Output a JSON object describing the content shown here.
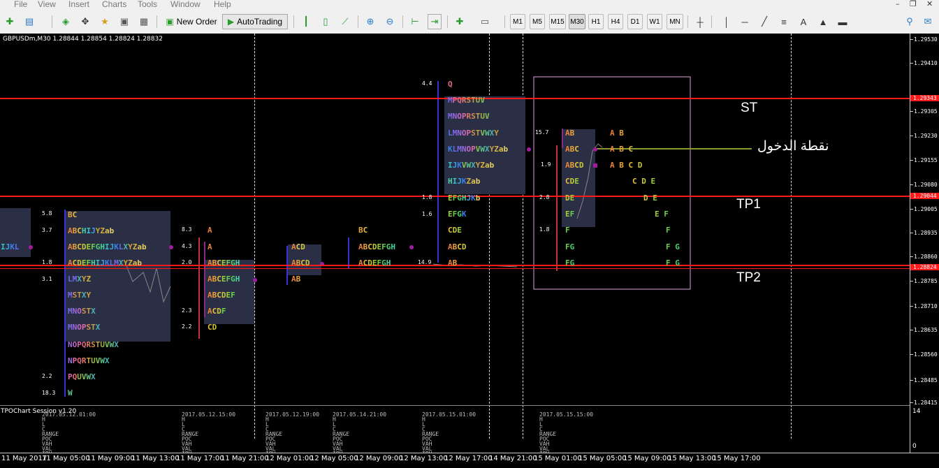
{
  "menu": [
    "File",
    "View",
    "Insert",
    "Charts",
    "Tools",
    "Window",
    "Help"
  ],
  "window_buttons": {
    "minimize": "–",
    "restore": "❐",
    "close": "✕"
  },
  "toolbar": {
    "new_order": "New Order",
    "auto_trading": "AutoTrading",
    "timeframes": [
      "M1",
      "M5",
      "M15",
      "M30",
      "H1",
      "H4",
      "D1",
      "W1",
      "MN"
    ],
    "active_timeframe": "M30"
  },
  "chart": {
    "symbol_info": "GBPUSDm,M30  1.28844 1.28854 1.28824 1.28832",
    "price_labels": [
      "1.29530",
      "1.29410",
      "1.29343",
      "1.29305",
      "1.29230",
      "1.29155",
      "1.29080",
      "1.29044",
      "1.29005",
      "1.28935",
      "1.28860",
      "1.28824",
      "1.28785",
      "1.28710",
      "1.28635",
      "1.28560",
      "1.28485",
      "1.28415"
    ],
    "highlighted_prices": [
      "1.29343",
      "1.29044",
      "1.28824"
    ],
    "time_labels": [
      "11 May 2017",
      "11 May 05:00",
      "11 May 09:00",
      "11 May 13:00",
      "11 May 17:00",
      "11 May 21:00",
      "12 May 01:00",
      "12 May 05:00",
      "12 May 09:00",
      "12 May 13:00",
      "12 May 17:00",
      "14 May 21:00",
      "15 May 01:00",
      "15 May 05:00",
      "15 May 09:00",
      "15 May 13:00",
      "15 May 17:00"
    ],
    "annotations": {
      "st": "ST",
      "entry": "نقطة الدخول",
      "tp1": "TP1",
      "tp2": "TP2"
    },
    "line_colors": {
      "levels": "#ff1a1a",
      "entry": "#8b9a2a",
      "frame": "#e0a0e0"
    },
    "indicator": {
      "title": "TPOChart Session v1.20",
      "max": "14",
      "min": "0"
    }
  },
  "sessions": [
    {
      "date": "2017.05.12.01:00",
      "nums": [
        "5.8",
        "3.7",
        "1.8",
        "3.1",
        "2.2",
        "18.3"
      ],
      "rows": [
        "BC",
        "ABCHIJYZab",
        "ABCDEFGHIJKLXYZab",
        "ACDEFHIJKLMXYZab",
        "LMXYZ",
        "MSTXY",
        "MNOSTX",
        "MNOPSTX",
        "NOPQRSTUVWX",
        "NPQRTUVWX",
        "PQUVWX",
        "W"
      ],
      "left": "IJKL"
    },
    {
      "date": "2017.05.12.15:00",
      "nums": [
        "8.3",
        "4.3",
        "2.0",
        "2.3",
        "2.2"
      ],
      "rows": [
        "A",
        "A",
        "ABCEFGH",
        "ABCEFGH",
        "ABCDEF",
        "ACDF",
        "CD"
      ]
    },
    {
      "date": "2017.05.12.19:00",
      "rows": [
        "ACD",
        "ABCD",
        "AB"
      ]
    },
    {
      "date": "2017.05.14.21:00",
      "rows": [
        "BC",
        "ABCDEFGH",
        "ACDEFGH"
      ]
    },
    {
      "date": "2017.05.15.01:00",
      "nums": [
        "4.4",
        "1.8",
        "1.6",
        "14.9"
      ],
      "rows": [
        "Q",
        "MPQRSTUV",
        "MNOPRSTUV",
        "LMNOPSTVWXY",
        "KLMNOPVWXYZab",
        "IJKVWXYZab",
        "HIJKZab",
        "EFGHJKb",
        "EFGK",
        "CDE",
        "ABCD",
        "AB"
      ]
    },
    {
      "date": "2017.05.15.15:00",
      "nums": [
        "15.7",
        "1.9",
        "2.8",
        "1.8"
      ],
      "rows": [
        "AB",
        "ABC",
        "ABCD",
        "CDE",
        "DE",
        "EF",
        "F",
        "FG",
        "FG"
      ],
      "right_rows": [
        "A B",
        "A B C",
        "A B C D",
        "C D E",
        "D E",
        "E F",
        "F",
        "F G",
        "F G"
      ]
    }
  ],
  "stat_labels": "H\nL\nC\nRANGE\nPOC\nVAH\nVAL\nIBH\nIBL"
}
